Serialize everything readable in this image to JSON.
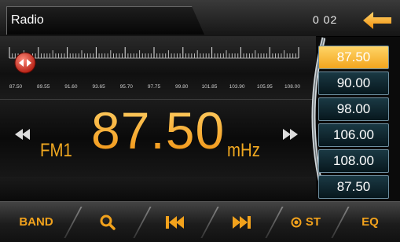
{
  "header": {
    "title": "Radio",
    "clock": "0 02",
    "back_icon": "back-arrow-icon"
  },
  "tuner": {
    "scale_labels": [
      "87.50",
      "89.55",
      "91.60",
      "93.65",
      "95.70",
      "97.75",
      "99.80",
      "101.85",
      "103.90",
      "105.95",
      "108.00"
    ],
    "band": "FM1",
    "frequency": "87.50",
    "unit": "mHz"
  },
  "presets": [
    "87.50",
    "90.00",
    "98.00",
    "106.00",
    "108.00",
    "87.50"
  ],
  "active_preset_index": 0,
  "toolbar": {
    "band": "BAND",
    "search_icon": "search-icon",
    "prev_icon": "skip-previous-icon",
    "next_icon": "skip-next-icon",
    "st": "ST",
    "eq": "EQ"
  },
  "colors": {
    "accent": "#f2a21c",
    "preset_bg": "#0e2a33",
    "preset_active": "#f5b02e"
  }
}
